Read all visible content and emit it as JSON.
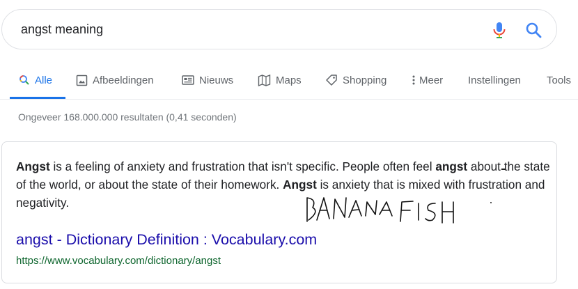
{
  "search": {
    "query": "angst meaning",
    "mic_icon": "microphone-icon",
    "search_icon": "search-icon"
  },
  "tabs": [
    {
      "label": "Alle",
      "icon": "search-icon",
      "active": true
    },
    {
      "label": "Afbeeldingen",
      "icon": "image-icon",
      "active": false
    },
    {
      "label": "Nieuws",
      "icon": "news-icon",
      "active": false
    },
    {
      "label": "Maps",
      "icon": "map-icon",
      "active": false
    },
    {
      "label": "Shopping",
      "icon": "tag-icon",
      "active": false
    },
    {
      "label": "Meer",
      "icon": "more-vert-icon",
      "active": false
    },
    {
      "label": "Instellingen",
      "active": false
    },
    {
      "label": "Tools",
      "active": false
    }
  ],
  "stats": "Ongeveer 168.000.000 resultaten (0,41 seconden)",
  "snippet": {
    "b1": "Angst",
    "t1": " is a feeling of anxiety and frustration that isn't specific. People often feel ",
    "b2": "angst",
    "t2": " about ",
    "struck": "the state of the world, or about the state of their homework.",
    "t3": " ",
    "b3": "Angst",
    "t4": " is anxiety that is mixed with frustration and negativity.",
    "handwriting": "BANANA FISH"
  },
  "result": {
    "title": "angst - Dictionary Definition : Vocabulary.com",
    "url": "https://www.vocabulary.com/dictionary/angst"
  },
  "colors": {
    "accent": "#1a73e8",
    "link": "#1a0dab",
    "url": "#0d652d",
    "muted": "#5f6368"
  }
}
